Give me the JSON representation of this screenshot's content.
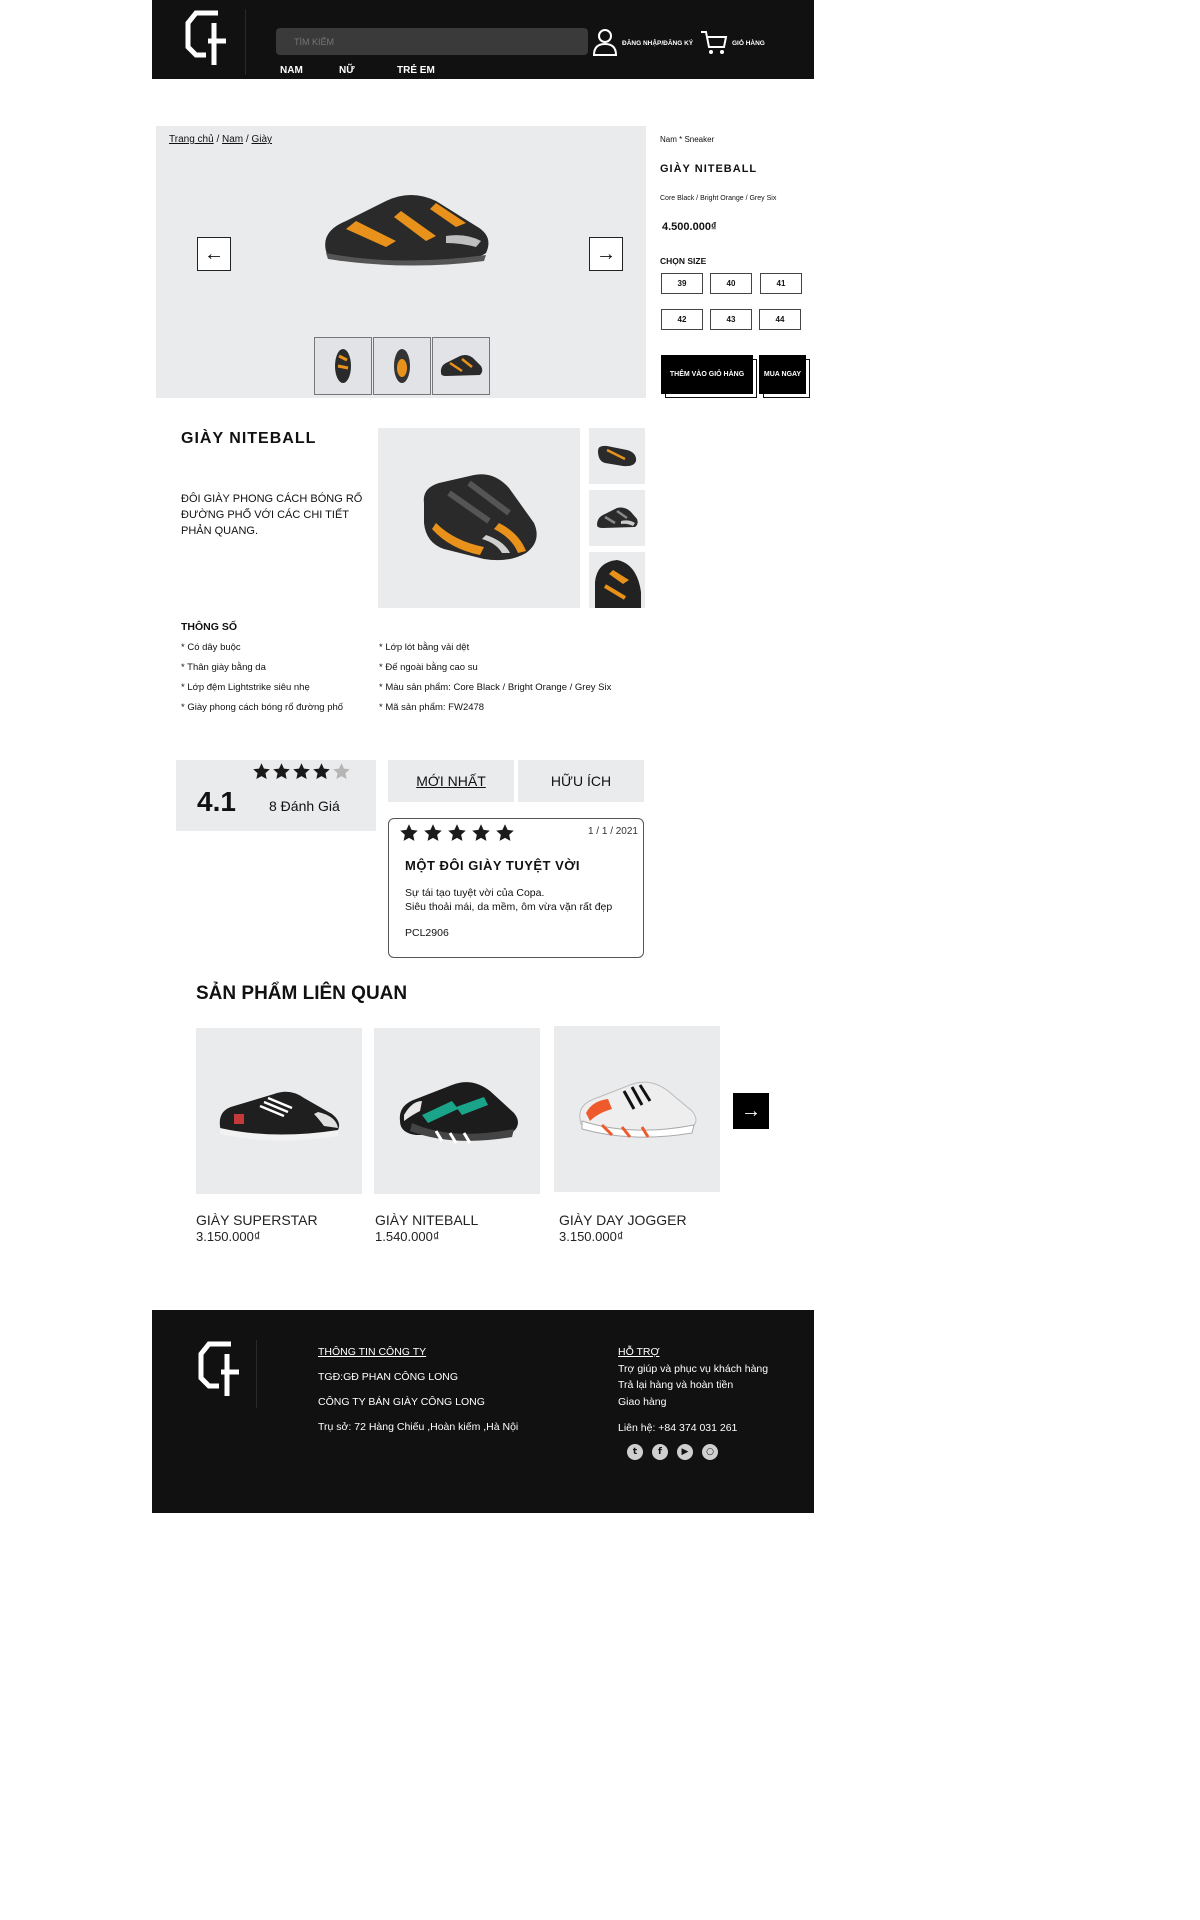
{
  "header": {
    "search_placeholder": "TÌM KIẾM",
    "login_label": "ĐĂNG NHẬP/ĐĂNG KÝ",
    "cart_label": "GIỎ HÀNG",
    "nav": [
      "NAM",
      "NỮ",
      "TRẺ EM"
    ]
  },
  "breadcrumb": {
    "home": "Trang chủ",
    "sep": "/",
    "cat": "Nam",
    "sub": "Giày"
  },
  "product": {
    "category": "Nam * Sneaker",
    "name": "GIÀY NITEBALL",
    "color": "Core Black / Bright Orange / Grey Six",
    "price": "4.500.000₫",
    "size_label": "CHỌN SIZE",
    "sizes": [
      "39",
      "40",
      "41",
      "42",
      "43",
      "44"
    ],
    "add_to_cart": "THÊM VÀO GIỎ HÀNG",
    "buy_now": "MUA NGAY"
  },
  "description": {
    "title": "GIÀY NITEBALL",
    "text": "ĐÔI GIÀY PHONG CÁCH BÓNG RỔ ĐƯỜNG PHỐ VỚI CÁC CHI TIẾT PHẢN QUANG.",
    "specs_title": "THÔNG SỐ",
    "specs_left": [
      "* Có dây buộc",
      "* Thân giày bằng da",
      "* Lớp đệm Lightstrike siêu nhẹ",
      "* Giày phong cách bóng rổ đường phố"
    ],
    "specs_right": [
      "* Lớp lót bằng vải dệt",
      "* Đế ngoài bằng cao su",
      "* Màu sản phẩm: Core Black / Bright Orange / Grey Six",
      "* Mã sản phẩm: FW2478"
    ]
  },
  "reviews": {
    "score": "4.1",
    "rating": 4,
    "count_label": "8 Đánh Giá",
    "tab_newest": "MỚI NHẤT",
    "tab_helpful": "HỮU ÍCH",
    "card": {
      "stars": 5,
      "date": "1 / 1 / 2021",
      "title": "MỘT ĐÔI GIÀY TUYỆT VỜI",
      "line1": "Sự tái tạo tuyệt vời của Copa.",
      "line2": "Siêu thoải mái, da mềm, ôm vừa vặn rất đẹp",
      "author": "PCL2906"
    }
  },
  "related": {
    "title": "SẢN PHẨM LIÊN QUAN",
    "items": [
      {
        "name": "GIÀY SUPERSTAR",
        "price": "3.150.000₫"
      },
      {
        "name": "GIÀY NITEBALL",
        "price": "1.540.000₫"
      },
      {
        "name": "GIÀY DAY JOGGER",
        "price": "3.150.000₫"
      }
    ]
  },
  "footer": {
    "company_title": "THÔNG TIN CÔNG TY",
    "ceo": "TGĐ:GĐ PHAN CÔNG LONG",
    "company": "CÔNG TY BÁN GIÀY CÔNG LONG",
    "address": "Trụ sở: 72 Hàng Chiếu ,Hoàn kiếm ,Hà Nội",
    "support_title": "HỖ TRỢ",
    "support_items": [
      "Trợ giúp và phục vụ khách hàng",
      "Trả lại hàng và hoàn tiền",
      "Giao hàng"
    ],
    "contact": "Liên hệ: +84 374 031 261",
    "socials": [
      "twitter-icon",
      "facebook-icon",
      "youtube-icon",
      "instagram-icon"
    ]
  },
  "colors": {
    "dark": "#111111",
    "panel": "#eaebed",
    "accent_orange": "#e8921c",
    "teal": "#1aa48a",
    "red_orange": "#ef5a2c"
  }
}
